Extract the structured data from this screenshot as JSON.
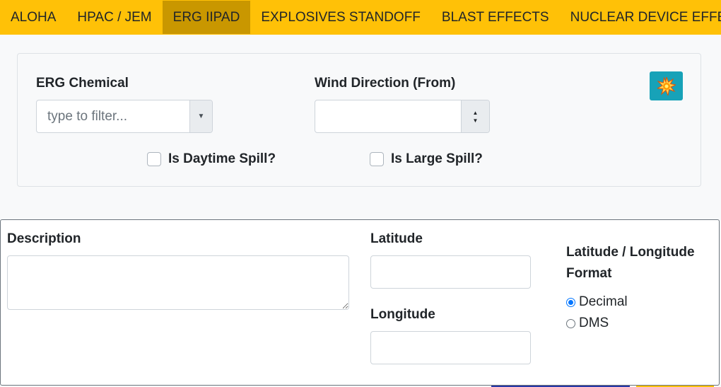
{
  "tabs": [
    {
      "label": "ALOHA",
      "active": false
    },
    {
      "label": "HPAC / JEM",
      "active": false
    },
    {
      "label": "ERG IIPAD",
      "active": true
    },
    {
      "label": "EXPLOSIVES STANDOFF",
      "active": false
    },
    {
      "label": "BLAST EFFECTS",
      "active": false
    },
    {
      "label": "NUCLEAR DEVICE EFFECTS",
      "active": false
    }
  ],
  "erg_form": {
    "chemical_label": "ERG Chemical",
    "chemical_placeholder": "type to filter...",
    "wind_label": "Wind Direction (From)",
    "wind_value": "",
    "action_icon": "explosion-icon",
    "daytime_spill_label": "Is Daytime Spill?",
    "daytime_spill_checked": false,
    "large_spill_label": "Is Large Spill?",
    "large_spill_checked": false
  },
  "location_form": {
    "description_label": "Description",
    "description_value": "",
    "latitude_label": "Latitude",
    "latitude_value": "",
    "longitude_label": "Longitude",
    "longitude_value": "",
    "format_label": "Latitude / Longitude Format",
    "format_options": [
      {
        "label": "Decimal",
        "selected": true
      },
      {
        "label": "DMS",
        "selected": false
      }
    ]
  },
  "colors": {
    "tabbar": "#ffc107",
    "active_tab": "#c99700",
    "action_button": "#17a2b8",
    "radio_accent": "#0075ff"
  }
}
